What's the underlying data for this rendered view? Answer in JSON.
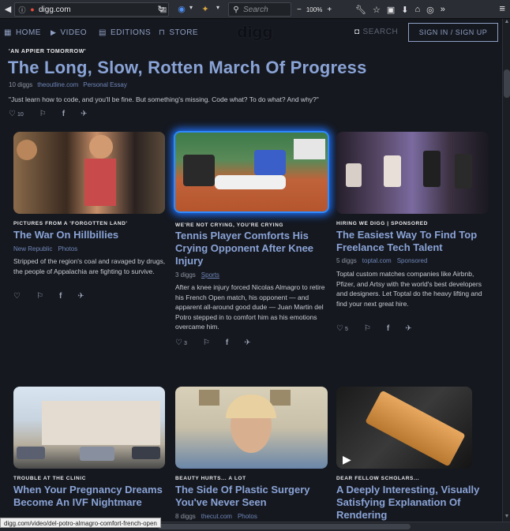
{
  "browser": {
    "url": "digg.com",
    "search_placeholder": "Search",
    "zoom": "100%",
    "status_url": "digg.com/video/del-potro-almagro-comfort-french-open"
  },
  "nav": {
    "home": "HOME",
    "video": "VIDEO",
    "editions": "EDITIONS",
    "store": "STORE",
    "logo": "digg",
    "search": "SEARCH",
    "signin": "SIGN IN / SIGN UP"
  },
  "hero": {
    "kicker": "'AN APPIER TOMORROW'",
    "title": "The Long, Slow, Rotten March Of Progress",
    "diggs": "10 diggs",
    "source": "theoutline.com",
    "tag": "Personal Essay",
    "description": "\"Just learn how to code, and you'll be fine. But something's missing. Code what? To do what? And why?\"",
    "digg_count": "10"
  },
  "cards": [
    {
      "kicker": "PICTURES FROM A 'FORGOTTEN LAND'",
      "title": "The War On Hillbillies",
      "diggs": "",
      "source": "New Republic",
      "tag": "Photos",
      "description": "Stripped of the region's coal and ravaged by drugs, the people of Appalachia are fighting to survive.",
      "digg_count": ""
    },
    {
      "kicker": "WE'RE NOT CRYING, YOU'RE CRYING",
      "title": "Tennis Player Comforts His Crying Opponent After Knee Injury",
      "diggs": "3 diggs",
      "source": "",
      "tag": "Sports",
      "description": "After a knee injury forced Nicolas Almagro to retire his French Open match, his opponent — and apparent all-around good dude — Juan Martin del Potro stepped in to comfort him as his emotions overcame him.",
      "digg_count": "3"
    },
    {
      "kicker": "HIRING WE DIGG | SPONSORED",
      "title": "The Easiest Way To Find Top Freelance Tech Talent",
      "diggs": "5 diggs",
      "source": "toptal.com",
      "tag": "Sponsored",
      "description": "Toptal custom matches companies like Airbnb, Pfizer, and Artsy with the world's best developers and designers. Let Toptal do the heavy lifting and find your next great hire.",
      "digg_count": "5"
    },
    {
      "kicker": "TROUBLE AT THE CLINIC",
      "title": "When Your Pregnancy Dreams Become An IVF Nightmare"
    },
    {
      "kicker": "BEAUTY HURTS... A LOT",
      "title": "The Side Of Plastic Surgery You've Never Seen",
      "diggs": "8 diggs",
      "source": "thecut.com",
      "tag": "Photos"
    },
    {
      "kicker": "DEAR FELLOW SCHOLARS...",
      "title": "A Deeply Interesting, Visually Satisfying Explanation Of Rendering"
    }
  ],
  "colors": {
    "accent": "#8aa3d6",
    "background": "#15181f",
    "highlight": "#2e8bff"
  }
}
